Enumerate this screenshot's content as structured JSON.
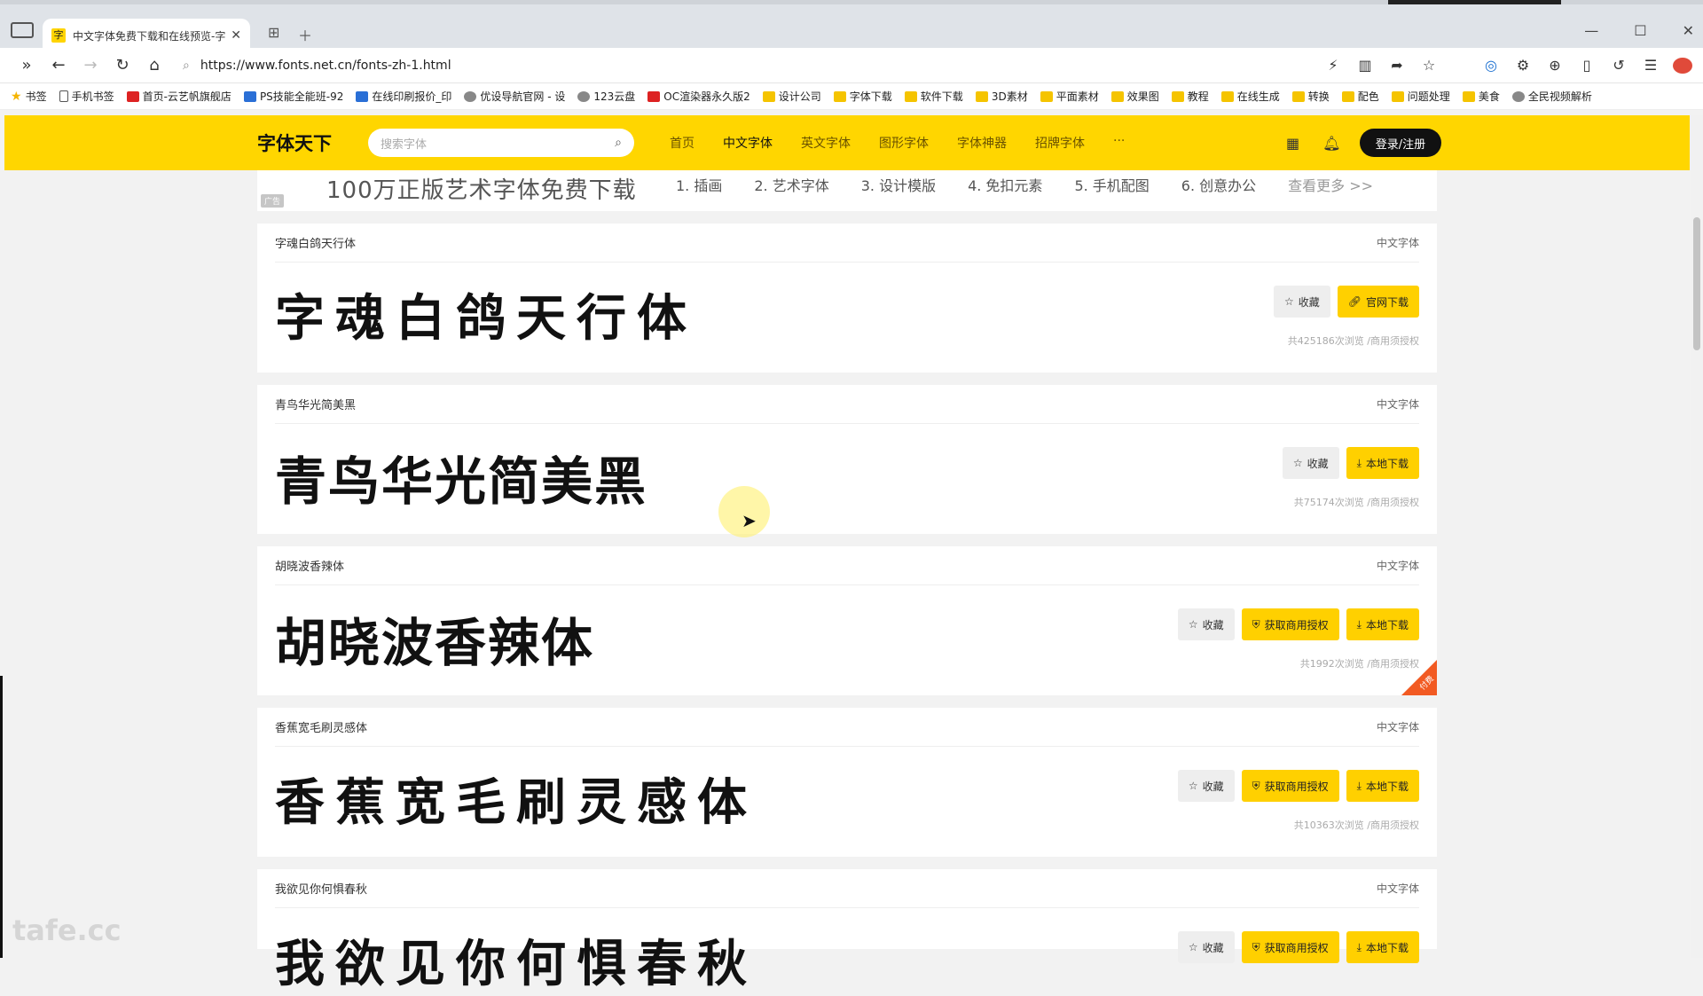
{
  "browser": {
    "tab_title": "中文字体免费下载和在线预览-字",
    "tab_favicon": "字",
    "url": "https://www.fonts.net.cn/fonts-zh-1.html",
    "bookmarks": [
      {
        "label": "书签",
        "icon": "star"
      },
      {
        "label": "手机书签",
        "icon": "page"
      },
      {
        "label": "首页-云艺帆旗舰店",
        "icon": "red"
      },
      {
        "label": "PS技能全能班-92",
        "icon": "blue"
      },
      {
        "label": "在线印刷报价_印",
        "icon": "blue"
      },
      {
        "label": "优设导航官网 - 设",
        "icon": "gray"
      },
      {
        "label": "123云盘",
        "icon": "gray"
      },
      {
        "label": "OC渲染器永久版2",
        "icon": "red"
      },
      {
        "label": "设计公司",
        "icon": "folder"
      },
      {
        "label": "字体下载",
        "icon": "folder"
      },
      {
        "label": "软件下载",
        "icon": "folder"
      },
      {
        "label": "3D素材",
        "icon": "folder"
      },
      {
        "label": "平面素材",
        "icon": "folder"
      },
      {
        "label": "效果图",
        "icon": "folder"
      },
      {
        "label": "教程",
        "icon": "folder"
      },
      {
        "label": "在线生成",
        "icon": "folder"
      },
      {
        "label": "转换",
        "icon": "folder"
      },
      {
        "label": "配色",
        "icon": "folder"
      },
      {
        "label": "问题处理",
        "icon": "folder"
      },
      {
        "label": "美食",
        "icon": "folder"
      },
      {
        "label": "全民视频解析",
        "icon": "gray"
      }
    ]
  },
  "site": {
    "logo": "字体天下",
    "search_placeholder": "搜索字体",
    "nav": [
      "首页",
      "中文字体",
      "英文字体",
      "图形字体",
      "字体神器",
      "招牌字体",
      "···"
    ],
    "active_nav": "中文字体",
    "login": "登录/注册",
    "accent_color": "#ffd600"
  },
  "ad": {
    "tag": "广告",
    "headline": "100万正版艺术字体免费下载",
    "links": [
      "1. 插画",
      "2. 艺术字体",
      "3. 设计模版",
      "4. 免扣元素",
      "5. 手机配图",
      "6. 创意办公"
    ],
    "more": "查看更多 >>"
  },
  "fonts": [
    {
      "name": "字魂白鸽天行体",
      "category": "中文字体",
      "preview": "字魂白鸽天行体",
      "fav": "收藏",
      "license": "",
      "download": "官网下载",
      "stats": "共425186次浏览 /商用须授权",
      "paid": false
    },
    {
      "name": "青鸟华光简美黑",
      "category": "中文字体",
      "preview": "青鸟华光简美黑",
      "fav": "收藏",
      "license": "",
      "download": "本地下载",
      "stats": "共75174次浏览 /商用须授权",
      "paid": false
    },
    {
      "name": "胡晓波香辣体",
      "category": "中文字体",
      "preview": "胡晓波香辣体",
      "fav": "收藏",
      "license": "获取商用授权",
      "download": "本地下载",
      "stats": "共1992次浏览 /商用须授权",
      "paid": true,
      "corner": "付费"
    },
    {
      "name": "香蕉宽毛刷灵感体",
      "category": "中文字体",
      "preview": "香蕉宽毛刷灵感体",
      "fav": "收藏",
      "license": "获取商用授权",
      "download": "本地下载",
      "stats": "共10363次浏览 /商用须授权",
      "paid": false
    },
    {
      "name": "我欲见你何惧春秋",
      "category": "中文字体",
      "preview": "我欲见你何惧春秋",
      "fav": "收藏",
      "license": "获取商用授权",
      "download": "本地下载",
      "stats": "",
      "paid": false
    }
  ],
  "watermark": "tafe.cc"
}
